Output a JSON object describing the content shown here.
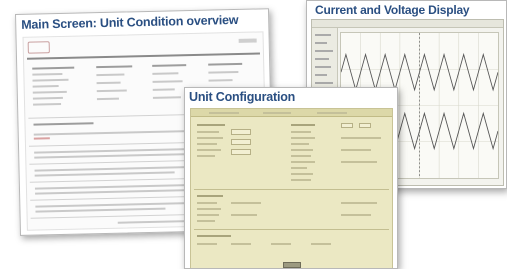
{
  "cards": {
    "main_screen": {
      "title": "Main Screen: Unit Condition overview"
    },
    "current_voltage": {
      "title": "Current and Voltage Display"
    },
    "unit_config": {
      "title": "Unit Configuration"
    }
  },
  "colors": {
    "title": "#2a4f82",
    "config_background": "#ebe8c3",
    "logo_accent": "#c23a3a"
  }
}
